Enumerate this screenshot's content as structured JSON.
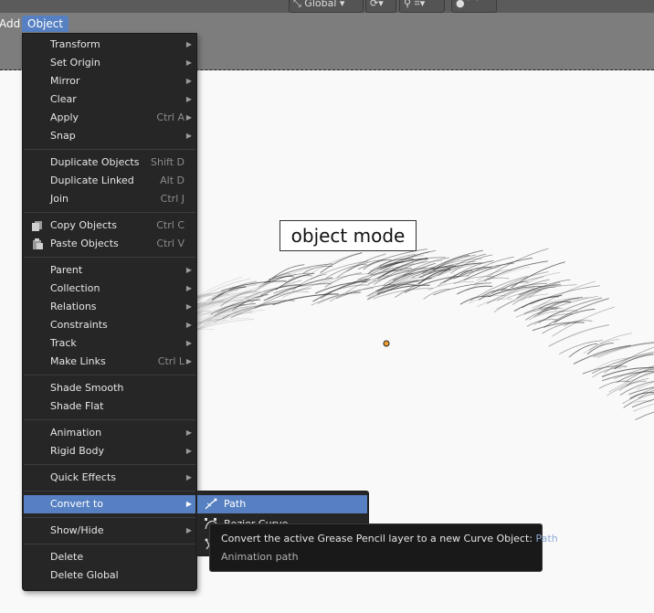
{
  "header": {
    "menus": [
      {
        "label": "Add"
      },
      {
        "label": "Object"
      }
    ],
    "orientation": "Global"
  },
  "object_menu": {
    "groups": [
      [
        {
          "label": "Transform",
          "submenu": true
        },
        {
          "label": "Set Origin",
          "submenu": true
        },
        {
          "label": "Mirror",
          "submenu": true
        },
        {
          "label": "Clear",
          "submenu": true
        },
        {
          "label": "Apply",
          "shortcut": "Ctrl A",
          "submenu": true
        },
        {
          "label": "Snap",
          "submenu": true
        }
      ],
      [
        {
          "label": "Duplicate Objects",
          "shortcut": "Shift D"
        },
        {
          "label": "Duplicate Linked",
          "shortcut": "Alt D"
        },
        {
          "label": "Join",
          "shortcut": "Ctrl J"
        }
      ],
      [
        {
          "label": "Copy Objects",
          "shortcut": "Ctrl C",
          "icon": "copy-icon"
        },
        {
          "label": "Paste Objects",
          "shortcut": "Ctrl V",
          "icon": "paste-icon"
        }
      ],
      [
        {
          "label": "Parent",
          "submenu": true
        },
        {
          "label": "Collection",
          "submenu": true
        },
        {
          "label": "Relations",
          "submenu": true
        },
        {
          "label": "Constraints",
          "submenu": true
        },
        {
          "label": "Track",
          "submenu": true
        },
        {
          "label": "Make Links",
          "shortcut": "Ctrl L",
          "submenu": true
        }
      ],
      [
        {
          "label": "Shade Smooth"
        },
        {
          "label": "Shade Flat"
        }
      ],
      [
        {
          "label": "Animation",
          "submenu": true
        },
        {
          "label": "Rigid Body",
          "submenu": true
        }
      ],
      [
        {
          "label": "Quick Effects",
          "submenu": true
        }
      ],
      [
        {
          "label": "Convert to",
          "submenu": true,
          "highlighted": true
        }
      ],
      [
        {
          "label": "Show/Hide",
          "submenu": true
        }
      ],
      [
        {
          "label": "Delete"
        },
        {
          "label": "Delete Global"
        }
      ]
    ]
  },
  "convert_submenu": {
    "items": [
      {
        "label": "Path",
        "highlighted": true,
        "icon": "curve-path-icon"
      },
      {
        "label": "Bezier Curve",
        "icon": "bezier-curve-icon"
      },
      {
        "label": "",
        "icon": "curve-icon"
      }
    ]
  },
  "tooltip": {
    "text": "Convert the active Grease Pencil layer to a new Curve Object:",
    "value": "Path",
    "python": "Animation path"
  },
  "viewport": {
    "mode_label": "object mode"
  },
  "colors": {
    "highlight": "#5680c2",
    "menu_bg": "#262626",
    "header_bg": "#7d7d7d"
  }
}
